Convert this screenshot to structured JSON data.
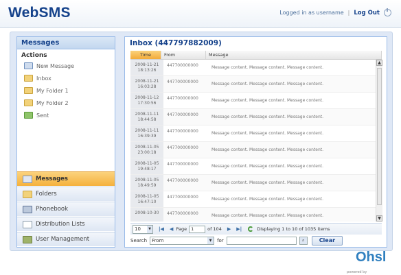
{
  "header": {
    "app_title": "WebSMS",
    "logged_in_text": "Logged in as username",
    "separator": "|",
    "logout_label": "Log Out"
  },
  "sidebar": {
    "title": "Messages",
    "actions_heading": "Actions",
    "actions": [
      {
        "label": "New Message",
        "icon": "new-message-icon"
      },
      {
        "label": "Inbox",
        "icon": "folder-icon"
      },
      {
        "label": "My Folder 1",
        "icon": "folder-icon"
      },
      {
        "label": "My Folder 2",
        "icon": "folder-icon"
      },
      {
        "label": "Sent",
        "icon": "sent-icon"
      }
    ],
    "accordion": [
      {
        "label": "Messages",
        "icon": "messages-icon",
        "active": true
      },
      {
        "label": "Folders",
        "icon": "folder-icon",
        "active": false
      },
      {
        "label": "Phonebook",
        "icon": "phonebook-icon",
        "active": false
      },
      {
        "label": "Distribution Lists",
        "icon": "list-icon",
        "active": false
      },
      {
        "label": "User Management",
        "icon": "user-icon",
        "active": false
      }
    ]
  },
  "inbox": {
    "title": "Inbox (447797882009)",
    "columns": {
      "time": "Time",
      "from": "From",
      "message": "Message"
    },
    "rows": [
      {
        "date": "2008-11-21",
        "time": "18:13:26",
        "from": "447700000000",
        "message": "Message content. Message content. Message content."
      },
      {
        "date": "2008-11-21",
        "time": "16:03:28",
        "from": "447700000000",
        "message": "Message content. Message content. Message content."
      },
      {
        "date": "2008-11-12",
        "time": "17:30:56",
        "from": "447700000000",
        "message": "Message content. Message content. Message content."
      },
      {
        "date": "2008-11-11",
        "time": "18:44:58",
        "from": "447700000000",
        "message": "Message content. Message content. Message content."
      },
      {
        "date": "2008-11-11",
        "time": "16:39:39",
        "from": "447700000000",
        "message": "Message content. Message content. Message content."
      },
      {
        "date": "2008-11-05",
        "time": "23:00:18",
        "from": "447700000000",
        "message": "Message content. Message content. Message content."
      },
      {
        "date": "2008-11-05",
        "time": "19:48:17",
        "from": "447700000000",
        "message": "Message content. Message content. Message content."
      },
      {
        "date": "2008-11-05",
        "time": "18:49:59",
        "from": "447700000000",
        "message": "Message content. Message content. Message content."
      },
      {
        "date": "2008-11-05",
        "time": "16:47:10",
        "from": "447700000000",
        "message": "Message content. Message content. Message content."
      },
      {
        "date": "2008-10-30",
        "time": "",
        "from": "447700000000",
        "message": "Message content. Message content. Message content."
      }
    ],
    "paging": {
      "page_size": "10",
      "page_label": "Page",
      "page_value": "1",
      "of_text": "of 104",
      "display_text": "Displaying 1 to 10 of 1035 items"
    },
    "search": {
      "label": "Search",
      "field_value": "From",
      "for_label": "for",
      "query_value": "",
      "clear_label": "Clear"
    }
  },
  "footer": {
    "brand": "Ohsl",
    "powered_by": "powered by"
  },
  "colors": {
    "brand_blue": "#15428b",
    "active_orange": "#f5b13d",
    "panel_border": "#99bbe8"
  }
}
